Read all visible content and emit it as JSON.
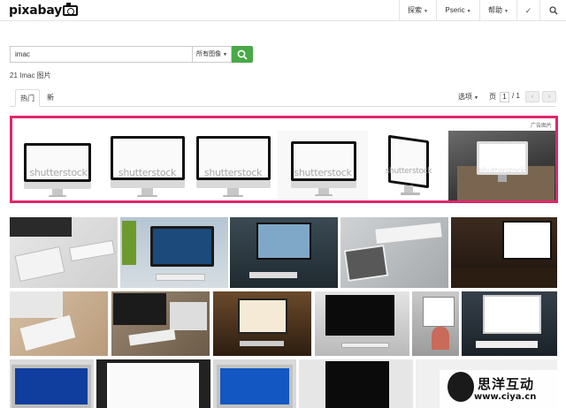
{
  "header": {
    "logo": "pixabay",
    "nav": [
      {
        "label": "探索"
      },
      {
        "label": "Pseric"
      },
      {
        "label": "帮助"
      }
    ]
  },
  "search": {
    "value": "imac",
    "filter": "所有图像"
  },
  "results": {
    "count": "21 Imac 图片"
  },
  "tabs": [
    {
      "label": "热门"
    },
    {
      "label": "新"
    }
  ],
  "toolbar": {
    "options": "选项",
    "page_label": "页",
    "page_value": "1",
    "page_total": "/ 1"
  },
  "ad": {
    "label": "广告图片",
    "watermark": "shutterstock"
  },
  "watermark": {
    "line1": "思洋互动",
    "line2": "www.ciya.cn"
  }
}
